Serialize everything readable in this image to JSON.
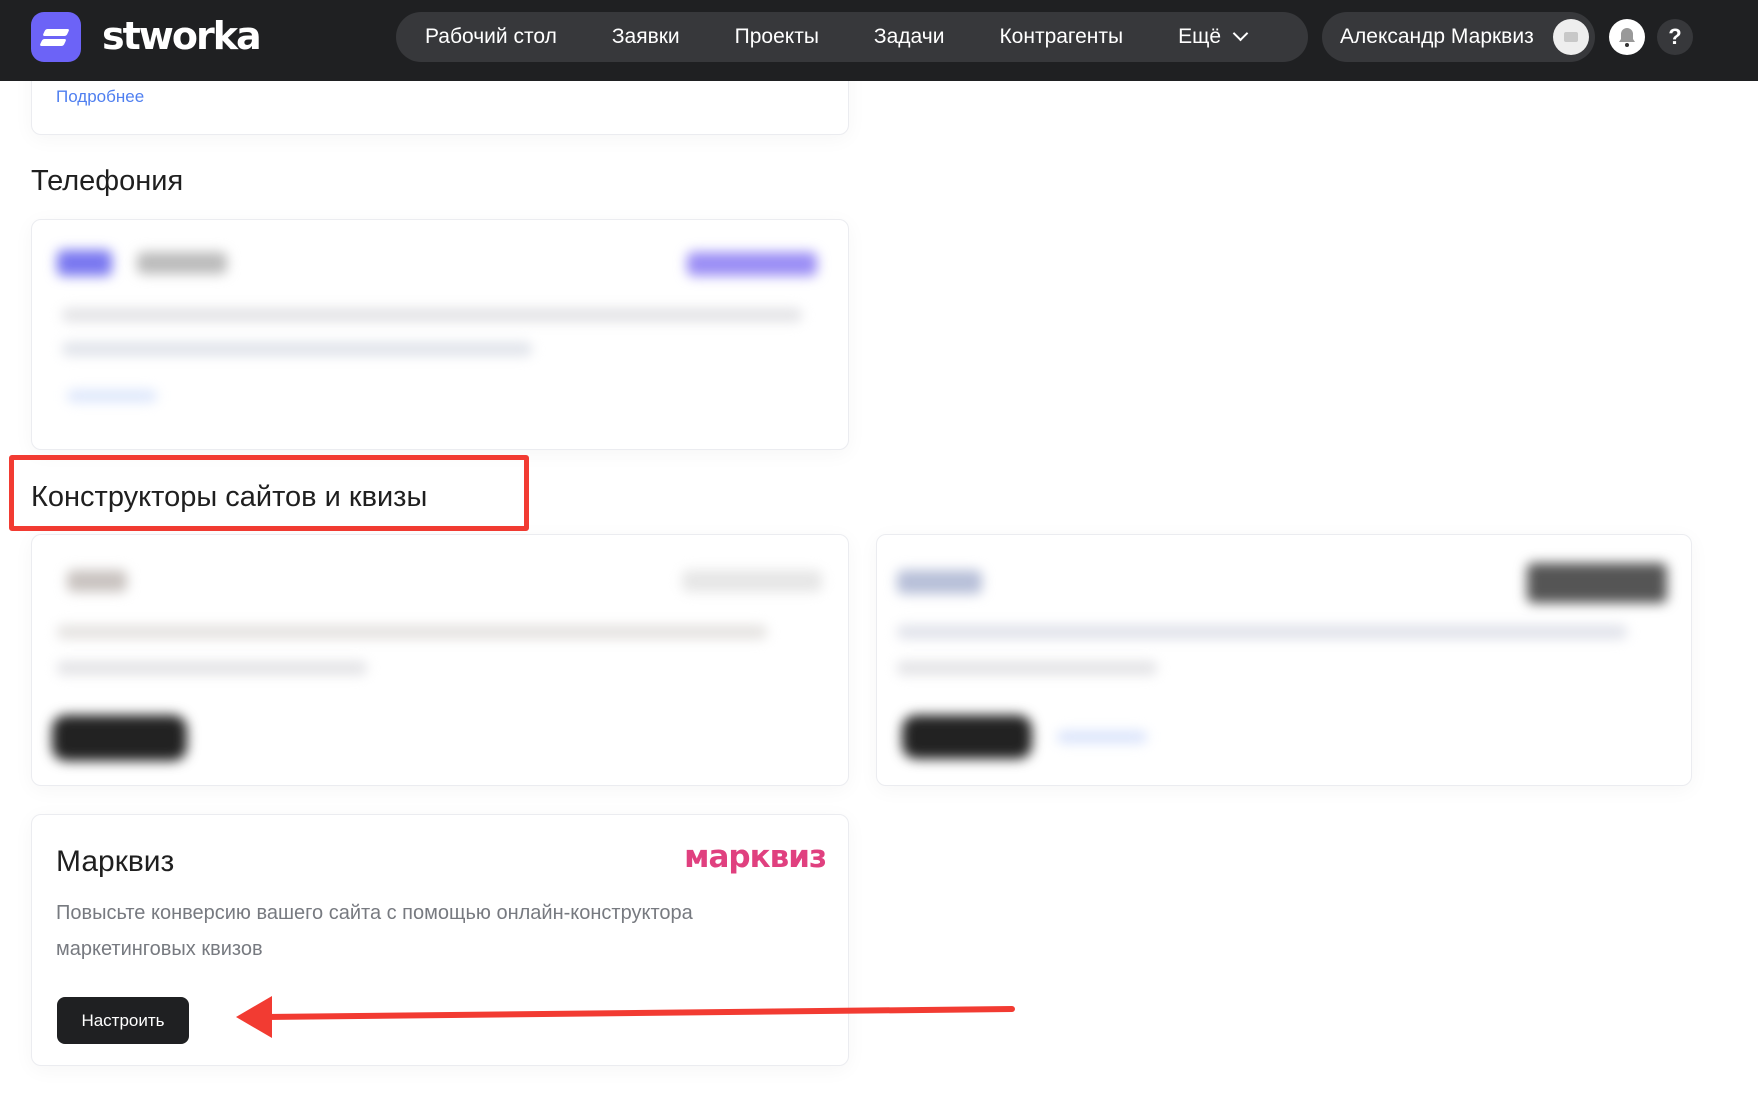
{
  "header": {
    "brand": "stworka",
    "menu": [
      "Рабочий стол",
      "Заявки",
      "Проекты",
      "Задачи",
      "Контрагенты",
      "Ещё"
    ],
    "user_name": "Александр Марквиз",
    "help": "?"
  },
  "top_card": {
    "link": "Подробнее"
  },
  "sections": {
    "telephony": "Телефония",
    "constructors": "Конструкторы сайтов и квизы"
  },
  "markviz": {
    "title": "Марквиз",
    "logo": "марквиз",
    "description": "Повысьте конверсию вашего сайта с помощью онлайн-конструктора маркетинговых квизов",
    "button": "Настроить"
  },
  "colors": {
    "accent": "#6c63f7",
    "highlight": "#f23b32",
    "brand_pink": "#e0407f"
  }
}
